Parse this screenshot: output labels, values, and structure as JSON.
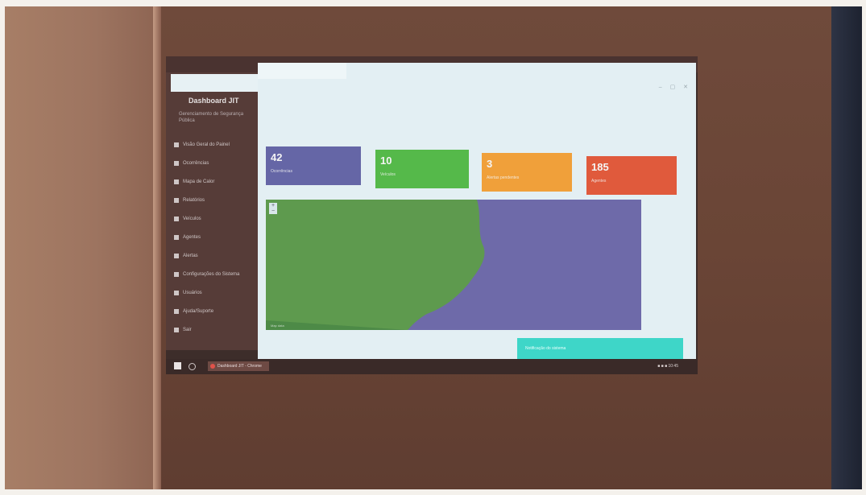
{
  "window": {
    "title": ""
  },
  "sidebar": {
    "brand": "Dashboard JIT",
    "subtitle": "Gerenciamento de Segurança Pública",
    "items": [
      {
        "label": "Visão Geral do Painel",
        "icon": "home-icon"
      },
      {
        "label": "Ocorrências",
        "icon": "list-icon"
      },
      {
        "label": "Mapa de Calor",
        "icon": "map-icon"
      },
      {
        "label": "Relatórios",
        "icon": "chart-icon"
      },
      {
        "label": "Veículos",
        "icon": "car-icon"
      },
      {
        "label": "Agentes",
        "icon": "users-icon"
      },
      {
        "label": "Alertas",
        "icon": "bell-icon"
      },
      {
        "label": "Configurações do Sistema",
        "icon": "gear-icon"
      },
      {
        "label": "Usuários",
        "icon": "user-icon"
      },
      {
        "label": "Ajuda/Suporte",
        "icon": "help-icon"
      },
      {
        "label": "Sair",
        "icon": "logout-icon"
      }
    ]
  },
  "window_controls": "– ▢ ✕",
  "tiles": [
    {
      "value": "42",
      "label": "Ocorrências",
      "color": "#6566a6"
    },
    {
      "value": "10",
      "label": "Veículos",
      "color": "#55b94a"
    },
    {
      "value": "3",
      "label": "Alertas pendentes",
      "color": "#f0a03a"
    },
    {
      "value": "185",
      "label": "Agentes",
      "color": "#e05a3c"
    }
  ],
  "map": {
    "land_color": "#5e9a4e",
    "sea_color": "#6e6aa9",
    "zoom_controls": "+ −",
    "attribution": "Map data"
  },
  "toast": {
    "text": "Notificação do sistema"
  },
  "taskbar": {
    "app_label": "Dashboard JIT - Chrome",
    "tray": "■ ■ ■ 10:45"
  }
}
